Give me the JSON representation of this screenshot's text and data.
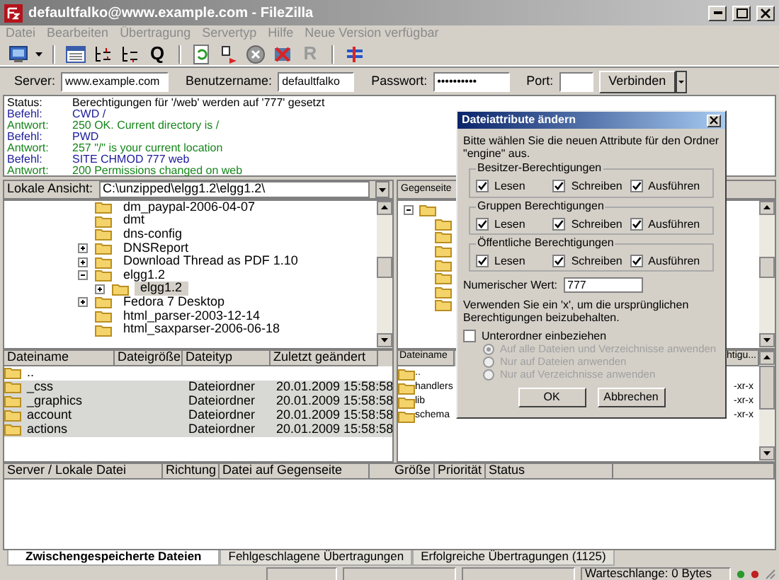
{
  "window": {
    "title": "defaultfalko@www.example.com - FileZilla"
  },
  "menu": [
    "Datei",
    "Bearbeiten",
    "Übertragung",
    "Servertyp",
    "Hilfe",
    "Neue Version verfügbar"
  ],
  "toolbar": [
    {
      "kind": "icon",
      "dropdown": true
    },
    {
      "kind": "separator"
    },
    {
      "kind": "icon"
    },
    {
      "kind": "icon"
    },
    {
      "kind": "icon"
    },
    {
      "kind": "glyph",
      "glyph": "Q",
      "disabled": false
    },
    {
      "kind": "separator"
    },
    {
      "kind": "icon"
    },
    {
      "kind": "icon"
    },
    {
      "kind": "icon"
    },
    {
      "kind": "icon"
    },
    {
      "kind": "glyph",
      "glyph": "R",
      "disabled": true
    },
    {
      "kind": "separator"
    },
    {
      "kind": "icon"
    }
  ],
  "quickconnect": {
    "fields": [
      {
        "label": "Server:",
        "value": "www.example.com"
      },
      {
        "label": "Benutzername:",
        "value": "defaultfalko"
      },
      {
        "label": "Passwort:",
        "value": "••••••••••"
      },
      {
        "label": "Port:"
      }
    ],
    "button": "Verbinden"
  },
  "log": [
    {
      "kind": "status",
      "label": "Status:",
      "text": "Berechtigungen für '/web' werden auf '777' gesetzt"
    },
    {
      "kind": "command",
      "label": "Befehl:",
      "text": "CWD /"
    },
    {
      "kind": "response",
      "label": "Antwort:",
      "text": "250 OK. Current directory is /"
    },
    {
      "kind": "command",
      "label": "Befehl:",
      "text": "PWD"
    },
    {
      "kind": "response",
      "label": "Antwort:",
      "text": "257 \"/\" is your current location"
    },
    {
      "kind": "command",
      "label": "Befehl:",
      "text": "SITE CHMOD 777 web"
    },
    {
      "kind": "response",
      "label": "Antwort:",
      "text": "200 Permissions changed on web"
    }
  ],
  "local": {
    "path_label": "Lokale Ansicht:",
    "path": "C:\\unzipped\\elgg1.2\\elgg1.2\\",
    "tree": [
      {
        "name": "dm_paypal-2006-04-07"
      },
      {
        "name": "dmt"
      },
      {
        "name": "dns-config"
      },
      {
        "name": "DNSReport",
        "expanded": false
      },
      {
        "name": "Download Thread as PDF 1.10",
        "expanded": false
      },
      {
        "name": "elgg1.2",
        "expanded": true,
        "children": [
          {
            "name": "elgg1.2",
            "expanded": false,
            "selected": true
          }
        ]
      },
      {
        "name": "Fedora 7 Desktop",
        "expanded": false
      },
      {
        "name": "html_parser-2003-12-14"
      },
      {
        "name": "html_saxparser-2006-06-18"
      }
    ],
    "columns": [
      "Dateiname",
      "Dateigröße",
      "Dateityp",
      "Zuletzt geändert"
    ],
    "rows": [
      {
        "name": "..",
        "selected": false
      },
      {
        "name": "_css",
        "type": "Dateiordner",
        "modified": "20.01.2009 15:58:58",
        "selected": true
      },
      {
        "name": "_graphics",
        "type": "Dateiordner",
        "modified": "20.01.2009 15:58:58",
        "selected": true
      },
      {
        "name": "account",
        "type": "Dateiordner",
        "modified": "20.01.2009 15:58:58",
        "selected": true
      },
      {
        "name": "actions",
        "type": "Dateiordner",
        "modified": "20.01.2009 15:58:58",
        "selected": true
      }
    ]
  },
  "remote": {
    "path_label": "Gegenseite",
    "columns": [
      "Dateiname",
      "htigu..."
    ],
    "rows": [
      {
        "name": ".."
      },
      {
        "name": "handlers",
        "permissions": "-xr-x"
      },
      {
        "name": "lib",
        "permissions": "-xr-x"
      },
      {
        "name": "schema",
        "permissions": "-xr-x"
      }
    ]
  },
  "queue": {
    "columns": [
      "Server / Lokale Datei",
      "Richtung",
      "Datei auf Gegenseite",
      "Größe",
      "Priorität",
      "Status"
    ],
    "tabs": [
      {
        "label": "Zwischengespeicherte Dateien",
        "selected": true
      },
      {
        "label": "Fehlgeschlagene Übertragungen",
        "selected": false
      },
      {
        "label": "Erfolgreiche Übertragungen (1125)",
        "selected": false
      }
    ]
  },
  "status_bar": {
    "queue": "Warteschlange: 0 Bytes"
  },
  "dialog": {
    "title": "Dateiattribute ändern",
    "intro": "Bitte wählen Sie die neuen Attribute für den Ordner \"engine\" aus.",
    "groups": [
      {
        "title": "Besitzer-Berechtigungen",
        "options": [
          {
            "label": "Lesen",
            "checked": true
          },
          {
            "label": "Schreiben",
            "checked": true
          },
          {
            "label": "Ausführen",
            "checked": true
          }
        ]
      },
      {
        "title": "Gruppen Berechtigungen",
        "options": [
          {
            "label": "Lesen",
            "checked": true
          },
          {
            "label": "Schreiben",
            "checked": true
          },
          {
            "label": "Ausführen",
            "checked": true
          }
        ]
      },
      {
        "title": "Öffentliche Berechtigungen",
        "options": [
          {
            "label": "Lesen",
            "checked": true
          },
          {
            "label": "Schreiben",
            "checked": true
          },
          {
            "label": "Ausführen",
            "checked": true
          }
        ]
      }
    ],
    "numeric_label": "Numerischer Wert:",
    "numeric_value": "777",
    "note": "Verwenden Sie ein 'x', um die ursprünglichen Berechtigungen beizubehalten.",
    "recurse": {
      "label": "Unterordner einbeziehen",
      "checked": false
    },
    "apply_options": [
      {
        "label": "Auf alle Dateien und Verzeichnisse anwenden",
        "selected": true,
        "disabled": true
      },
      {
        "label": "Nur auf Dateien anwenden",
        "selected": false,
        "disabled": true
      },
      {
        "label": "Nur auf Verzeichnisse anwenden",
        "selected": false,
        "disabled": true
      }
    ],
    "buttons": [
      "OK",
      "Abbrechen"
    ]
  }
}
